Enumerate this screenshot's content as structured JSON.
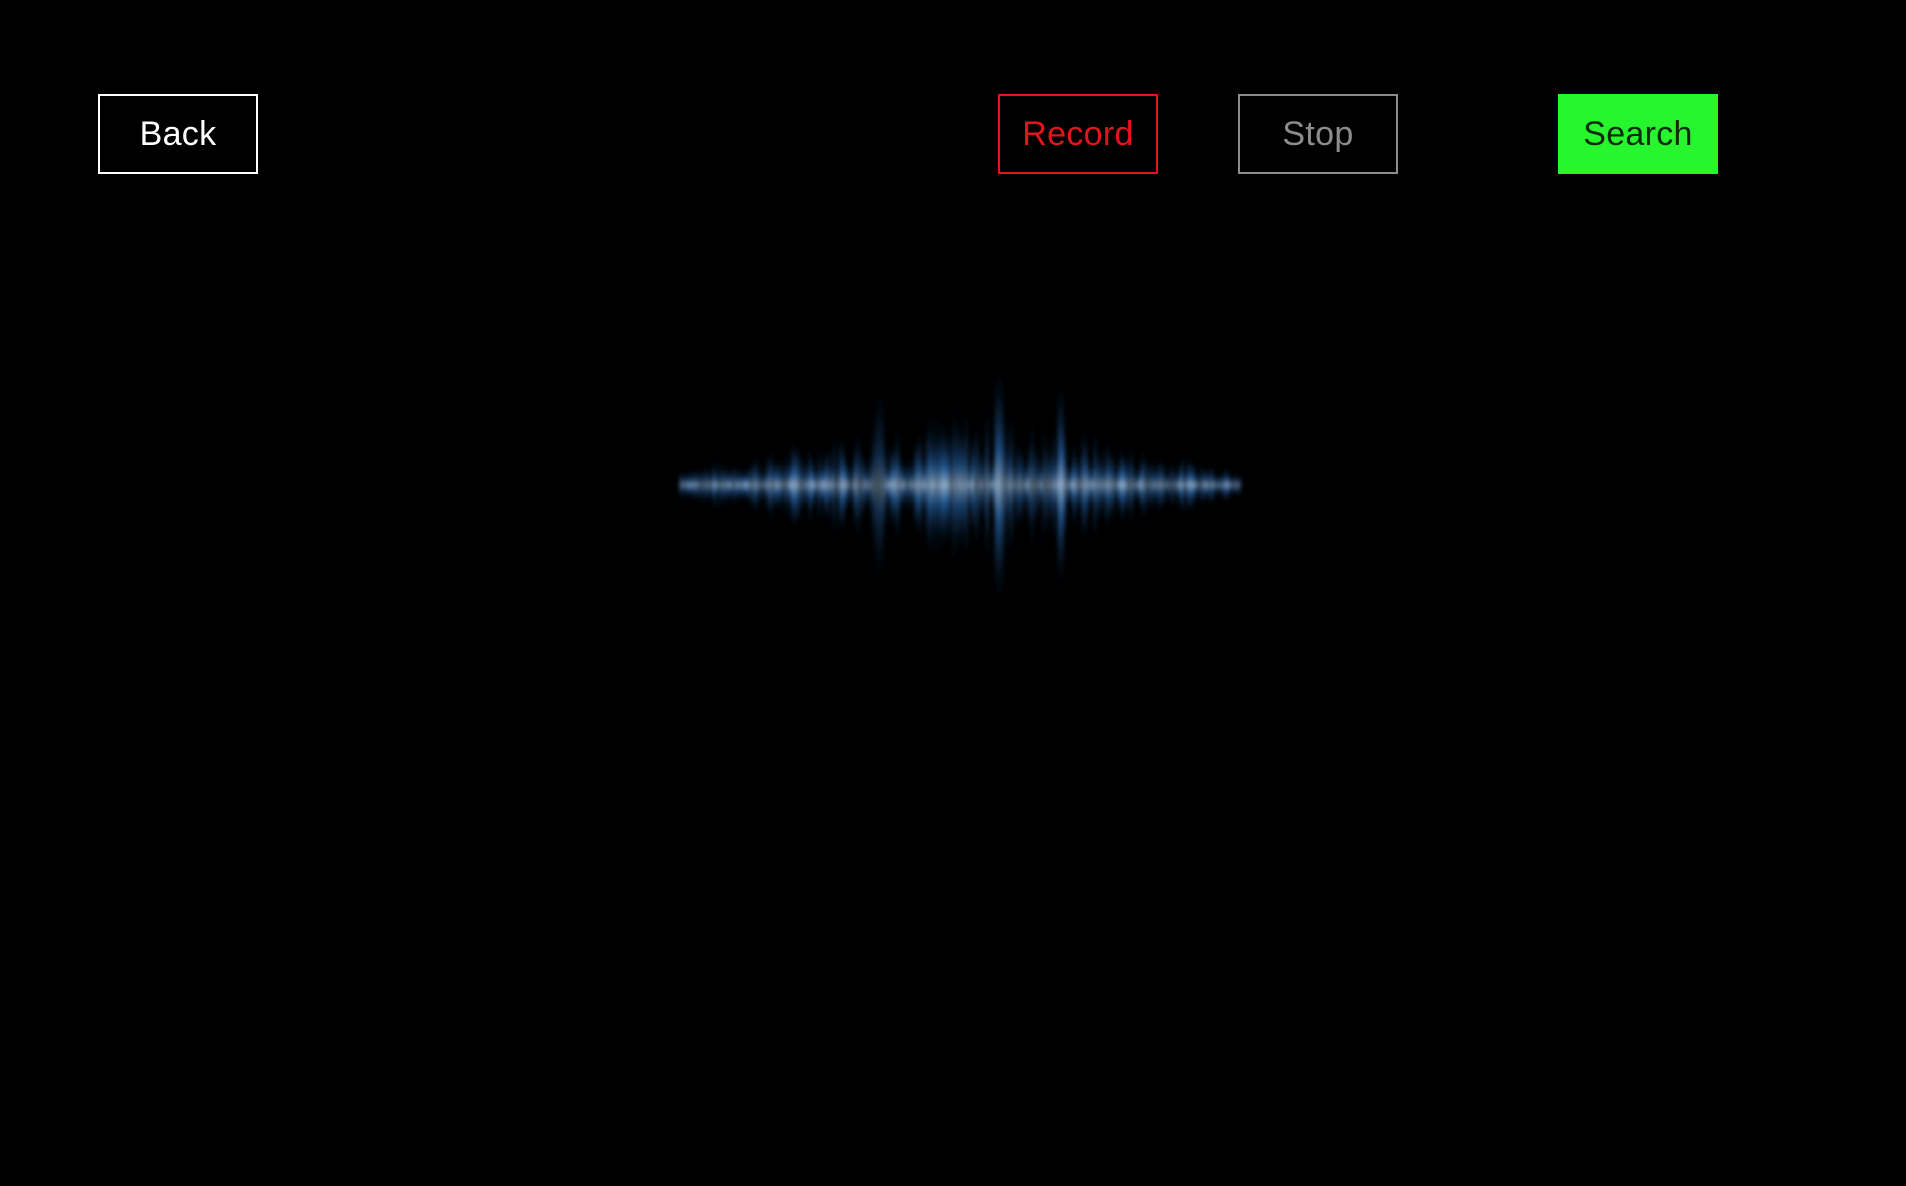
{
  "toolbar": {
    "back_label": "Back",
    "record_label": "Record",
    "stop_label": "Stop",
    "search_label": "Search"
  },
  "colors": {
    "background": "#000000",
    "back": "#ffffff",
    "record": "#e3141b",
    "stop": "#8c8c8c",
    "search_bg": "#27f52e",
    "search_text": "#0d2a0d",
    "waveform": "#3f8fe0"
  },
  "waveform": {
    "icon": "audio-waveform-icon"
  }
}
